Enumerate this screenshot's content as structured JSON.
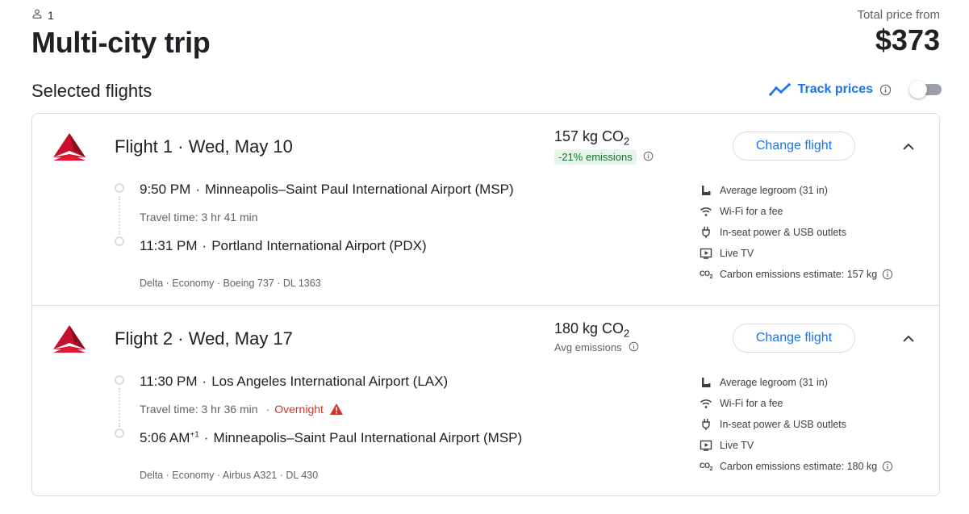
{
  "header": {
    "passengers": "1",
    "title": "Multi-city trip",
    "price_label": "Total price from",
    "price": "$373"
  },
  "section": {
    "title": "Selected flights",
    "track_prices_label": "Track prices",
    "track_prices_on": false
  },
  "colors": {
    "accent": "#1a73e8",
    "delta_red": "#c8102e",
    "badge_green_bg": "#e6f4ea",
    "badge_green_text": "#137333",
    "warning_red": "#d93025"
  },
  "flights": [
    {
      "title": "Flight 1 · Wed, May 10",
      "airline_logo": "delta-logo",
      "emissions": "157 kg CO",
      "emissions_sub": "2",
      "emissions_note": "-21% emissions",
      "emissions_note_style": "badge",
      "change_label": "Change flight",
      "depart_time": "9:50 PM",
      "depart_airport": "Minneapolis–Saint Paul International Airport (MSP)",
      "travel_time": "Travel time: 3 hr 41 min",
      "overnight": "",
      "arrive_time": "11:31 PM",
      "arrive_day_offset": "",
      "arrive_airport": "Portland International Airport (PDX)",
      "meta": "Delta · Economy · Boeing 737 · DL 1363",
      "amenities": [
        {
          "icon": "legroom-icon",
          "label": "Average legroom (31 in)"
        },
        {
          "icon": "wifi-icon",
          "label": "Wi-Fi for a fee"
        },
        {
          "icon": "power-icon",
          "label": "In-seat power & USB outlets"
        },
        {
          "icon": "tv-icon",
          "label": "Live TV"
        },
        {
          "icon": "co2-icon",
          "label": "Carbon emissions estimate: 157 kg"
        }
      ]
    },
    {
      "title": "Flight 2 · Wed, May 17",
      "airline_logo": "delta-logo",
      "emissions": "180 kg CO",
      "emissions_sub": "2",
      "emissions_note": "Avg emissions",
      "emissions_note_style": "plain",
      "change_label": "Change flight",
      "depart_time": "11:30 PM",
      "depart_airport": "Los Angeles International Airport (LAX)",
      "travel_time": "Travel time: 3 hr 36 min",
      "overnight": "Overnight",
      "arrive_time": "5:06 AM",
      "arrive_day_offset": "+1",
      "arrive_airport": "Minneapolis–Saint Paul International Airport (MSP)",
      "meta": "Delta · Economy · Airbus A321 · DL 430",
      "amenities": [
        {
          "icon": "legroom-icon",
          "label": "Average legroom (31 in)"
        },
        {
          "icon": "wifi-icon",
          "label": "Wi-Fi for a fee"
        },
        {
          "icon": "power-icon",
          "label": "In-seat power & USB outlets"
        },
        {
          "icon": "tv-icon",
          "label": "Live TV"
        },
        {
          "icon": "co2-icon",
          "label": "Carbon emissions estimate: 180 kg"
        }
      ]
    }
  ]
}
